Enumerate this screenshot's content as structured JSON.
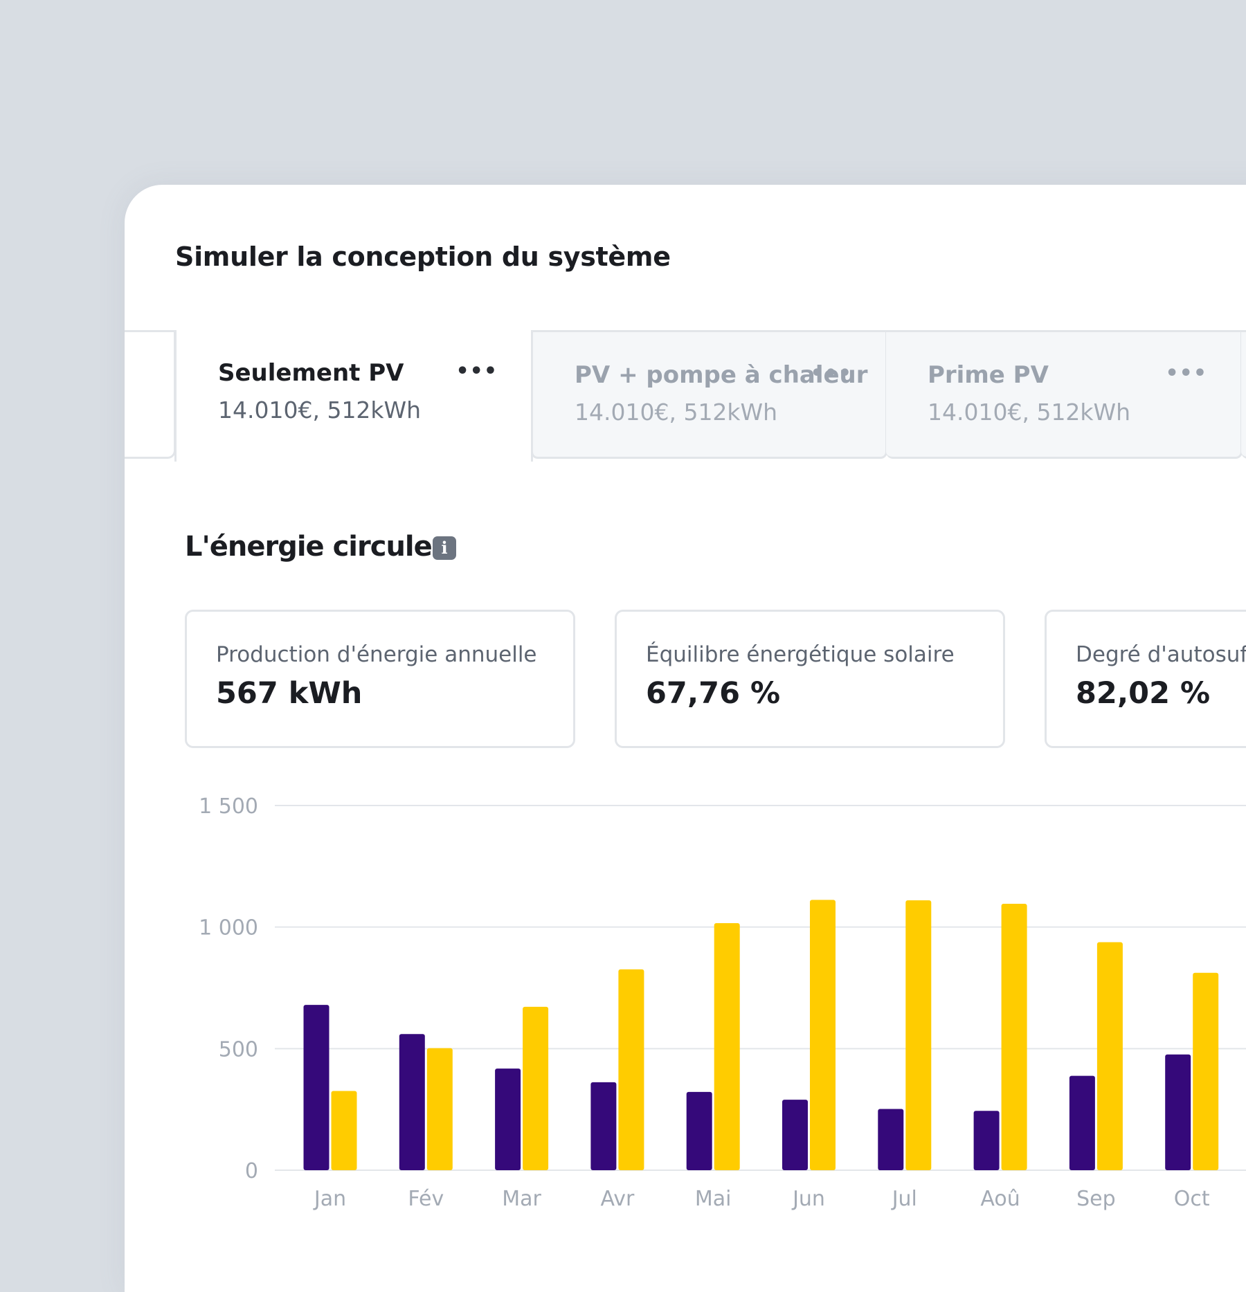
{
  "header": {
    "title": "Simuler la conception du système"
  },
  "tabs": [
    {
      "name": "Seulement PV",
      "subtitle": "14.010€, 512kWh",
      "menu": "•••",
      "active": true
    },
    {
      "name": "PV + pompe à chaleur",
      "subtitle": "14.010€, 512kWh",
      "menu": "•••",
      "active": false
    },
    {
      "name": "Prime PV",
      "subtitle": "14.010€, 512kWh",
      "menu": "•••",
      "active": false
    }
  ],
  "section": {
    "title": "L'énergie circule",
    "info_icon": "i"
  },
  "stats": [
    {
      "label": "Production d'énergie annuelle",
      "value": "567 kWh"
    },
    {
      "label": "Équilibre énergétique solaire",
      "value": "67,76 %"
    },
    {
      "label": "Degré d'autosuffisance",
      "value": "82,02 %"
    }
  ],
  "colors": {
    "series_1": "#35097a",
    "series_2": "#ffcc00",
    "grid": "#e3e6ea",
    "tick_text": "#a3aab4"
  },
  "chart_data": {
    "type": "bar",
    "categories": [
      "Jan",
      "Fév",
      "Mar",
      "Avr",
      "Mai",
      "Jun",
      "Jul",
      "Aoû",
      "Sep",
      "Oct"
    ],
    "series": [
      {
        "values": [
          680,
          560,
          418,
          362,
          322,
          290,
          252,
          244,
          388,
          476
        ]
      },
      {
        "values": [
          326,
          502,
          672,
          826,
          1016,
          1112,
          1110,
          1096,
          938,
          812
        ]
      }
    ],
    "yticks": [
      "0",
      "500",
      "1 000",
      "1 500"
    ],
    "ylim": [
      0,
      1500
    ],
    "grid": true
  }
}
